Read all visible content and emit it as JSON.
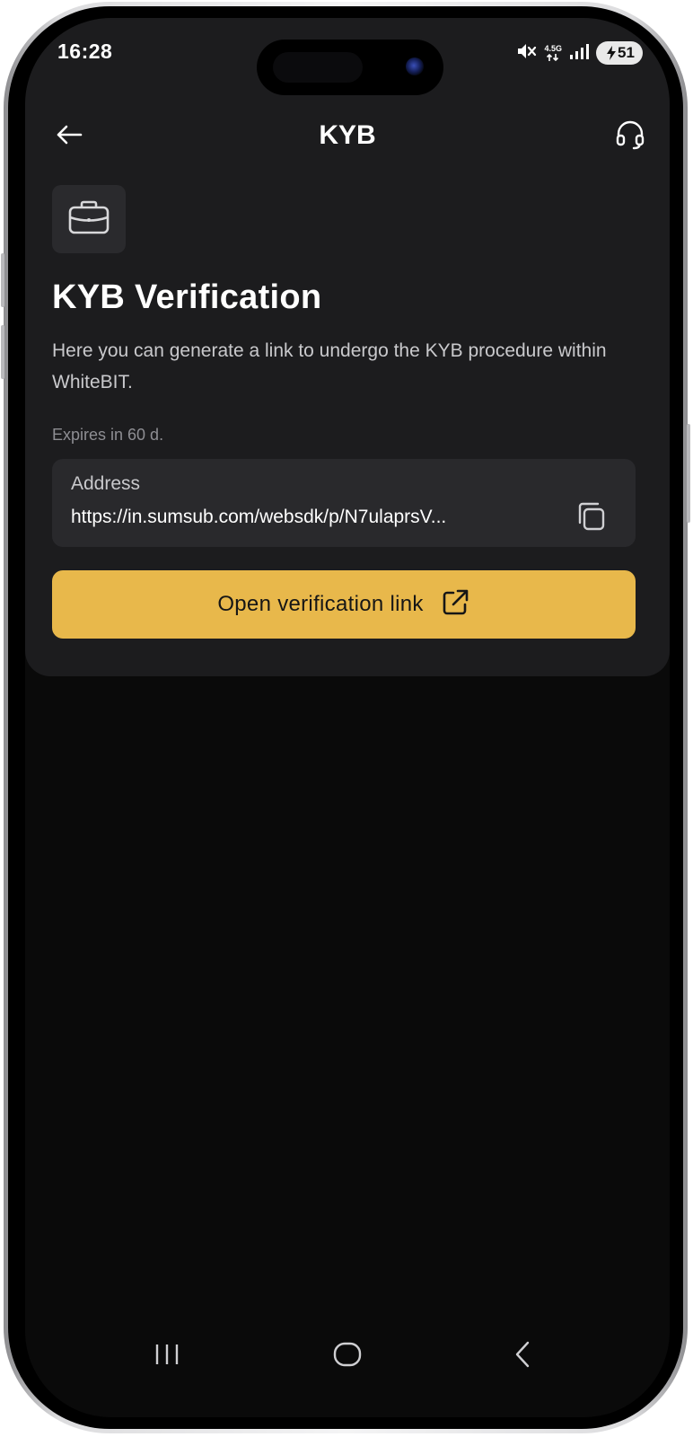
{
  "status_bar": {
    "time": "16:28",
    "network": "4.5G",
    "battery_level": "51"
  },
  "header": {
    "title": "KYB"
  },
  "content": {
    "title": "KYB Verification",
    "description": "Here you can generate a link to undergo the KYB procedure within WhiteBIT.",
    "expires": "Expires in 60 d.",
    "address": {
      "label": "Address",
      "value": "https://in.sumsub.com/websdk/p/N7ulaprsV..."
    },
    "open_button_label": "Open verification link"
  },
  "icons": {
    "back": "arrow-left-icon",
    "support": "headset-icon",
    "tile": "briefcase-icon",
    "copy": "copy-icon",
    "open": "external-link-icon",
    "nav_recents": "recents-icon",
    "nav_home": "home-icon",
    "nav_back": "nav-back-icon"
  },
  "colors": {
    "accent": "#e8b84b",
    "panel": "#1c1c1e",
    "background": "#0a0a0a"
  }
}
